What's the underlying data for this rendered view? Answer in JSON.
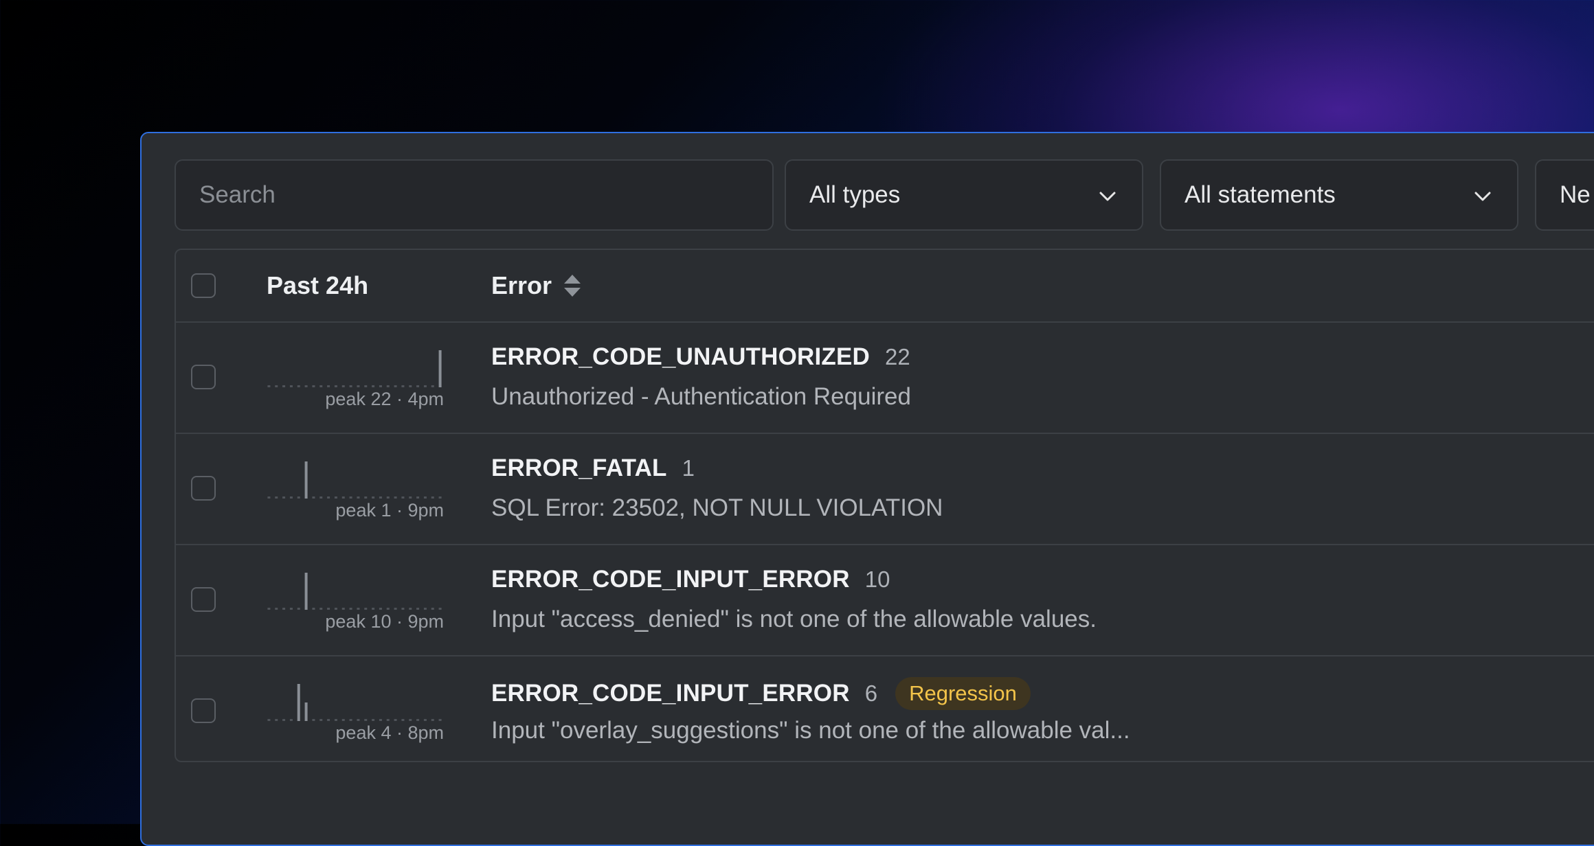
{
  "filters": {
    "search_placeholder": "Search",
    "type_select": "All types",
    "statement_select": "All statements",
    "third_select": "Ne"
  },
  "table": {
    "headers": {
      "past": "Past 24h",
      "error": "Error"
    },
    "rows": [
      {
        "code": "ERROR_CODE_UNAUTHORIZED",
        "count": "22",
        "badge": "",
        "message": "Unauthorized - Authentication Required",
        "peak": "peak 22 · 4pm",
        "spark": [
          0,
          0,
          0,
          0,
          0,
          0,
          0,
          0,
          0,
          0,
          0,
          0,
          0,
          0,
          0,
          0,
          0,
          0,
          0,
          0,
          0,
          0,
          0,
          22
        ],
        "spark_max": 22
      },
      {
        "code": "ERROR_FATAL",
        "count": "1",
        "badge": "",
        "message": "SQL Error: 23502, NOT NULL VIOLATION",
        "peak": "peak 1 · 9pm",
        "spark": [
          0,
          0,
          0,
          0,
          0,
          1,
          0,
          0,
          0,
          0,
          0,
          0,
          0,
          0,
          0,
          0,
          0,
          0,
          0,
          0,
          0,
          0,
          0,
          0
        ],
        "spark_max": 1
      },
      {
        "code": "ERROR_CODE_INPUT_ERROR",
        "count": "10",
        "badge": "",
        "message": "Input \"access_denied\" is not one of the allowable values.",
        "peak": "peak 10 · 9pm",
        "spark": [
          0,
          0,
          0,
          0,
          0,
          10,
          0,
          0,
          0,
          0,
          0,
          0,
          0,
          0,
          0,
          0,
          0,
          0,
          0,
          0,
          0,
          0,
          0,
          0
        ],
        "spark_max": 10
      },
      {
        "code": "ERROR_CODE_INPUT_ERROR",
        "count": "6",
        "badge": "Regression",
        "message": "Input \"overlay_suggestions\" is not one of the allowable val...",
        "peak": "peak 4 · 8pm",
        "spark": [
          0,
          0,
          0,
          0,
          4,
          2,
          0,
          0,
          0,
          0,
          0,
          0,
          0,
          0,
          0,
          0,
          0,
          0,
          0,
          0,
          0,
          0,
          0,
          0
        ],
        "spark_max": 4
      }
    ]
  },
  "colors": {
    "accent_border": "#2f6fe0",
    "badge_text": "#f3c44a",
    "badge_bg": "#3e3520",
    "spark_bar": "#8a8f96"
  },
  "icons": [
    "chevron-down-icon",
    "sort-icon"
  ]
}
